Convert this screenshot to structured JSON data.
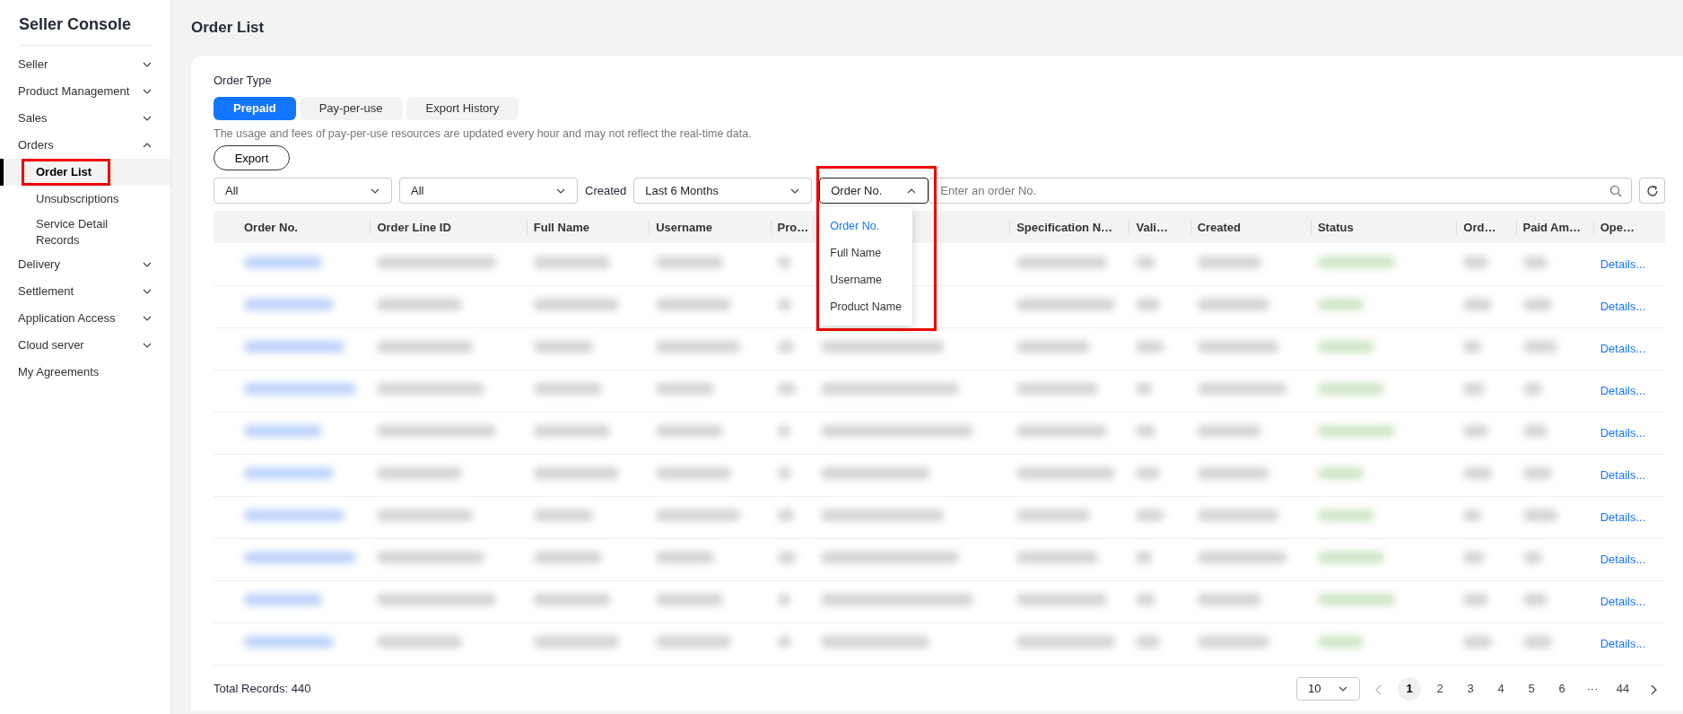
{
  "sidebar": {
    "title": "Seller Console",
    "items": [
      {
        "kind": "group",
        "label": "Seller",
        "expanded": false
      },
      {
        "kind": "group",
        "label": "Product Management",
        "expanded": false
      },
      {
        "kind": "group",
        "label": "Sales",
        "expanded": false
      },
      {
        "kind": "group",
        "label": "Orders",
        "expanded": true,
        "children": [
          {
            "label": "Order List",
            "selected": true,
            "highlighted": true
          },
          {
            "label": "Unsubscriptions",
            "selected": false,
            "highlighted": false
          },
          {
            "label": "Service Detail Records",
            "selected": false,
            "highlighted": false
          }
        ]
      },
      {
        "kind": "group",
        "label": "Delivery",
        "expanded": false
      },
      {
        "kind": "group",
        "label": "Settlement",
        "expanded": false
      },
      {
        "kind": "group",
        "label": "Application Access",
        "expanded": false
      },
      {
        "kind": "group",
        "label": "Cloud server",
        "expanded": false
      },
      {
        "kind": "link",
        "label": "My Agreements"
      }
    ]
  },
  "page_title": "Order List",
  "order_type": {
    "label": "Order Type",
    "tabs": [
      {
        "label": "Prepaid",
        "selected": true
      },
      {
        "label": "Pay-per-use",
        "selected": false
      },
      {
        "label": "Export History",
        "selected": false
      }
    ]
  },
  "notice": "The usage and fees of pay-per-use resources are updated every hour and may not reflect the real-time data.",
  "export_button": "Export",
  "filters": {
    "selects": [
      {
        "value": "All"
      },
      {
        "value": "All"
      }
    ],
    "created_label": "Created",
    "period_select": {
      "value": "Last 6 Months"
    },
    "field_select": {
      "value": "Order No.",
      "expanded": true,
      "highlighted": true,
      "options": [
        {
          "label": "Order No.",
          "selected": true
        },
        {
          "label": "Full Name",
          "selected": false
        },
        {
          "label": "Username",
          "selected": false
        },
        {
          "label": "Product Name",
          "selected": false
        }
      ]
    },
    "search": {
      "placeholder": "Enter an order No."
    }
  },
  "table": {
    "columns": [
      "Order No.",
      "Order Line ID",
      "Full Name",
      "Username",
      "Pro…",
      "Specification N…",
      "Vali…",
      "Created",
      "Status",
      "Ord…",
      "Paid Am…",
      "Ope…"
    ],
    "rows": [
      {
        "operation": "Details..."
      },
      {
        "operation": "Details..."
      },
      {
        "operation": "Details..."
      },
      {
        "operation": "Details..."
      },
      {
        "operation": "Details..."
      },
      {
        "operation": "Details..."
      },
      {
        "operation": "Details..."
      },
      {
        "operation": "Details..."
      },
      {
        "operation": "Details..."
      },
      {
        "operation": "Details..."
      }
    ]
  },
  "footer": {
    "total": "Total Records: 440",
    "page_size": "10",
    "prev_disabled": true,
    "next_disabled": false,
    "pages": [
      {
        "label": "1",
        "selected": true
      },
      {
        "label": "2",
        "selected": false
      },
      {
        "label": "3",
        "selected": false
      },
      {
        "label": "4",
        "selected": false
      },
      {
        "label": "5",
        "selected": false
      },
      {
        "label": "6",
        "selected": false
      },
      {
        "label": "···",
        "selected": false
      },
      {
        "label": "44",
        "selected": false
      }
    ]
  }
}
